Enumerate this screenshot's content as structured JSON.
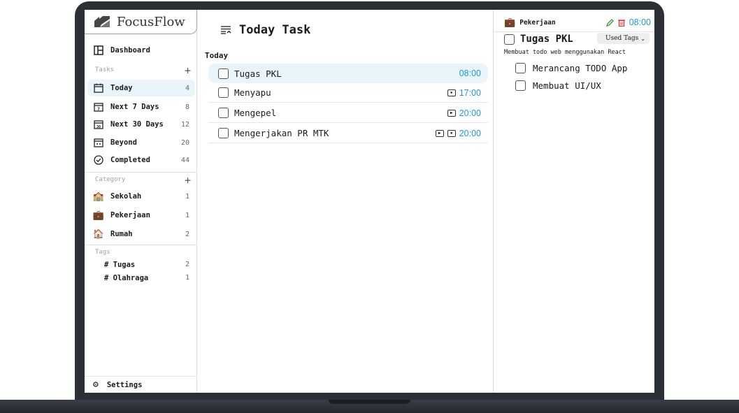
{
  "app": {
    "name": "FocusFlow"
  },
  "sidebar": {
    "dashboard": "Dashboard",
    "tasks_header": "Tasks",
    "tasks": [
      {
        "label": "Today",
        "count": "4",
        "icon": "calendar-today-icon"
      },
      {
        "label": "Next 7 Days",
        "count": "8",
        "icon": "calendar-7-icon"
      },
      {
        "label": "Next 30 Days",
        "count": "12",
        "icon": "calendar-30-icon"
      },
      {
        "label": "Beyond",
        "count": "20",
        "icon": "calendar-beyond-icon"
      },
      {
        "label": "Completed",
        "count": "44",
        "icon": "check-circle-icon"
      }
    ],
    "category_header": "Category",
    "categories": [
      {
        "label": "Sekolah",
        "count": "1",
        "emoji": "🏫"
      },
      {
        "label": "Pekerjaan",
        "count": "1",
        "emoji": "💼"
      },
      {
        "label": "Rumah",
        "count": "2",
        "emoji": "🏠"
      }
    ],
    "tags_header": "Tags",
    "tags": [
      {
        "label": "# Tugas",
        "count": "2"
      },
      {
        "label": "# Olahraga",
        "count": "1"
      }
    ],
    "settings": "Settings"
  },
  "main": {
    "title": "Today Task",
    "group": "Today",
    "tasks": [
      {
        "name": "Tugas PKL",
        "time": "08:00"
      },
      {
        "name": "Menyapu",
        "time": "17:00"
      },
      {
        "name": "Mengepel",
        "time": "20:00"
      },
      {
        "name": "Mengerjakan PR MTK",
        "time": "20:00"
      }
    ]
  },
  "detail": {
    "category": "Pekerjaan",
    "time": "08:00",
    "title": "Tugas PKL",
    "tags_select": "Used Tags",
    "description": "Membuat todo web menggunakan React",
    "subtasks": [
      "Merancang TODO App",
      "Membuat UI/UX"
    ]
  },
  "colors": {
    "accent": "#1a9ad6",
    "selected_bg": "#eaf4fb",
    "frame": "#2b2f36"
  }
}
